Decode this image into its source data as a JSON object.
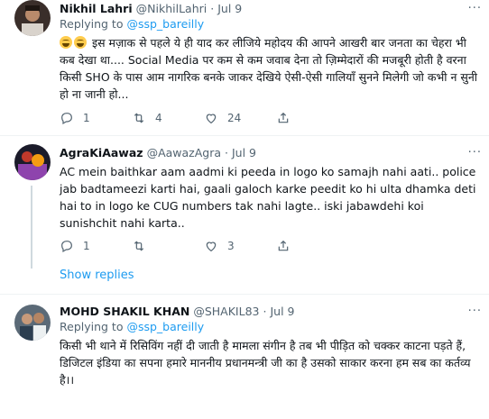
{
  "tweets": [
    {
      "name": "Nikhil Lahri",
      "handle": "@NikhilLahri",
      "dot": "·",
      "date": "Jul 9",
      "replying_prefix": "Replying to",
      "replying_handle": "@ssp_bareilly",
      "text": "इस मज़ाक से पहले ये ही याद कर लीजिये महोदय की आपने आखरी बार जनता का चेहरा भी कब देखा था.... Social Media पर कम से कम जवाब देना तो ज़िम्मेदारों की मजबूरी होती है वरना किसी SHO के पास आम नागरिक बनके जाकर देखिये ऐसी-ऐसी गालियाँ सुनने मिलेगी जो कभी न सुनी हो ना जानी हो...",
      "replies": "1",
      "retweets": "4",
      "likes": "24"
    },
    {
      "name": "AgraKiAawaz",
      "handle": "@AawazAgra",
      "dot": "·",
      "date": "Jul 9",
      "text": "AC mein baithkar aam aadmi ki peeda in logo ko samajh nahi aati.. police jab badtameezi karti hai, gaali galoch karke peedit ko hi ulta dhamka deti hai to in logo ke CUG numbers tak nahi lagte.. iski jabawdehi koi sunishchit nahi karta..",
      "replies": "1",
      "retweets": "",
      "likes": "3"
    },
    {
      "name": "MOHD SHAKIL KHAN",
      "handle": "@SHAKIL83",
      "dot": "·",
      "date": "Jul 9",
      "replying_prefix": "Replying to",
      "replying_handle": "@ssp_bareilly",
      "text": "किसी भी थाने में रिसिविंग नहीं दी जाती है मामला संगीन है तब भी पीड़ित को चक्कर काटना पड़ते हैं, डिजिटल इंडिया का सपना हमारे माननीय प्रधानमन्त्री जी का है उसको साकार करना हम सब का कर्तव्य है।।"
    }
  ],
  "show_replies": "Show replies",
  "more_glyph": "···",
  "icons": {
    "reply": "reply-icon",
    "retweet": "retweet-icon",
    "like": "like-icon",
    "share": "share-icon",
    "more": "more-icon"
  },
  "colors": {
    "link": "#1d9bf0",
    "secondary_text": "#536471",
    "divider": "#eff3f4"
  }
}
